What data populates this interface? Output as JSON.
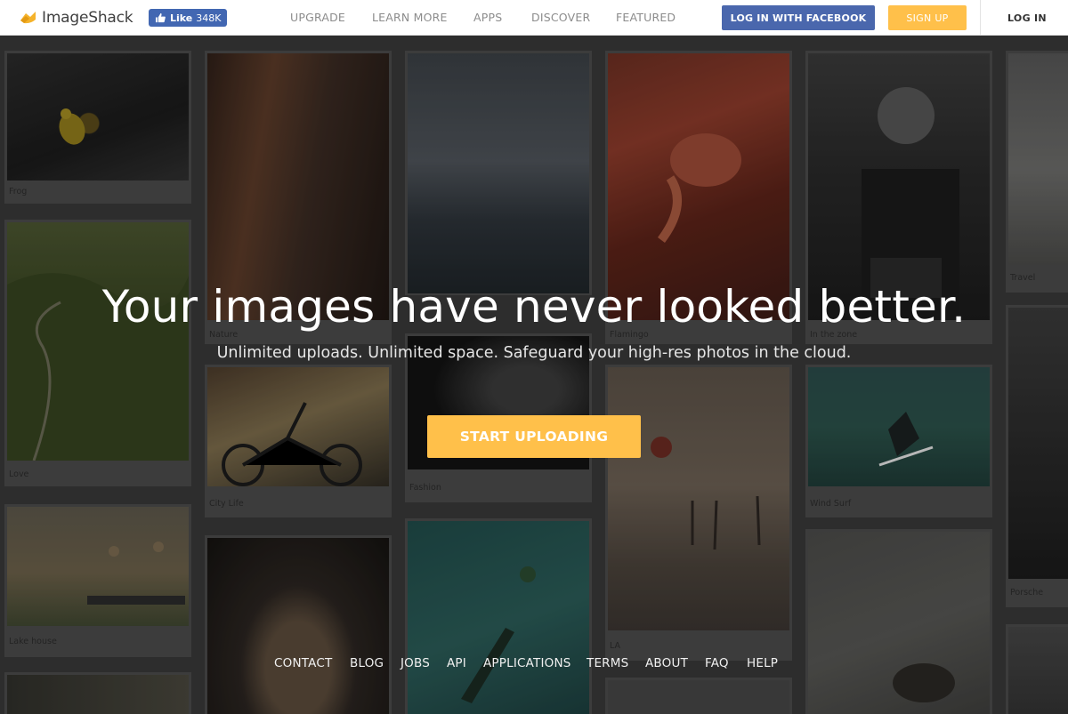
{
  "header": {
    "logo_text": "ImageShack",
    "logo_icon": "imageshack-logo",
    "fb_like_label": "Like",
    "fb_like_count": "348K",
    "nav": [
      "UPGRADE",
      "LEARN MORE",
      "APPS",
      "DISCOVER",
      "FEATURED"
    ],
    "login_facebook": "LOG IN WITH FACEBOOK",
    "signup": "SIGN UP",
    "login": "LOG IN"
  },
  "hero": {
    "title": "Your images have never looked better.",
    "subtitle": "Unlimited uploads. Unlimited space. Safeguard your high-res photos in the cloud.",
    "cta": "START UPLOADING"
  },
  "gallery": {
    "captions": [
      "Frog",
      "Love",
      "Lake house",
      "Nature",
      "City Life",
      "Fashion",
      "Flamingo",
      "LA",
      "In the zone",
      "Wind Surf",
      "Travel",
      "Porsche"
    ]
  },
  "footer": {
    "links": [
      "CONTACT",
      "BLOG",
      "JOBS",
      "API",
      "APPLICATIONS",
      "TERMS",
      "ABOUT",
      "FAQ",
      "HELP"
    ]
  },
  "colors": {
    "accent": "#ffc04a",
    "facebook": "#4a67ad",
    "nav_text": "#8c8c8c"
  }
}
